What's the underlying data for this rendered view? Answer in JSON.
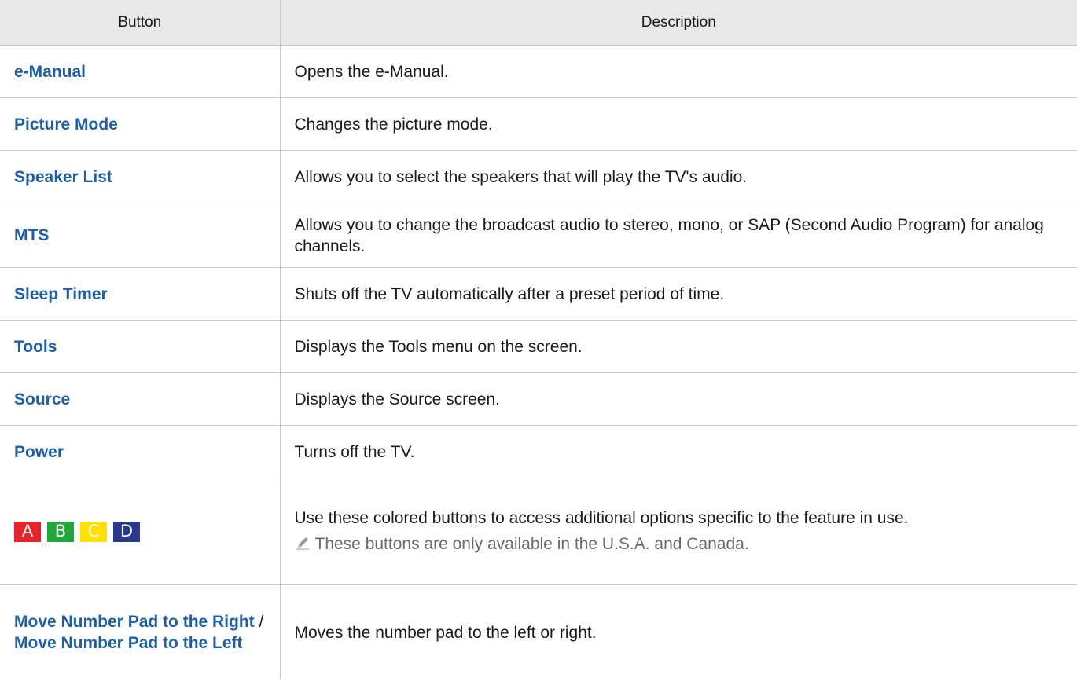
{
  "headers": {
    "button": "Button",
    "description": "Description"
  },
  "rows": [
    {
      "button": "e-Manual",
      "description": "Opens the e-Manual."
    },
    {
      "button": "Picture Mode",
      "description": "Changes the picture mode."
    },
    {
      "button": "Speaker List",
      "description": "Allows you to select the speakers that will play the TV's audio."
    },
    {
      "button": "MTS",
      "description": "Allows you to change the broadcast audio to stereo, mono, or SAP (Second Audio Program) for analog channels."
    },
    {
      "button": "Sleep Timer",
      "description": "Shuts off the TV automatically after a preset period of time."
    },
    {
      "button": "Tools",
      "description": "Displays the Tools menu on the screen."
    },
    {
      "button": "Source",
      "description": "Displays the Source screen."
    },
    {
      "button": "Power",
      "description": "Turns off the TV."
    }
  ],
  "color_keys": {
    "keys": [
      {
        "label": "A",
        "color": "#e8232b"
      },
      {
        "label": "B",
        "color": "#22a83a"
      },
      {
        "label": "C",
        "color": "#ffe000"
      },
      {
        "label": "D",
        "color": "#2a3990"
      }
    ],
    "description": "Use these colored buttons to access additional options specific to the feature in use.",
    "note_icon": "pencil-note-icon",
    "note": "These buttons are only available in the U.S.A. and Canada."
  },
  "number_pad": {
    "button_part1": "Move Number Pad to the Right",
    "separator": " / ",
    "button_part2": "Move Number Pad to the Left",
    "description": "Moves the number pad to the left or right."
  },
  "colors": {
    "link": "#1d5fa8",
    "header_bg": "#e8e8e8",
    "border": "#c8c8c8"
  }
}
